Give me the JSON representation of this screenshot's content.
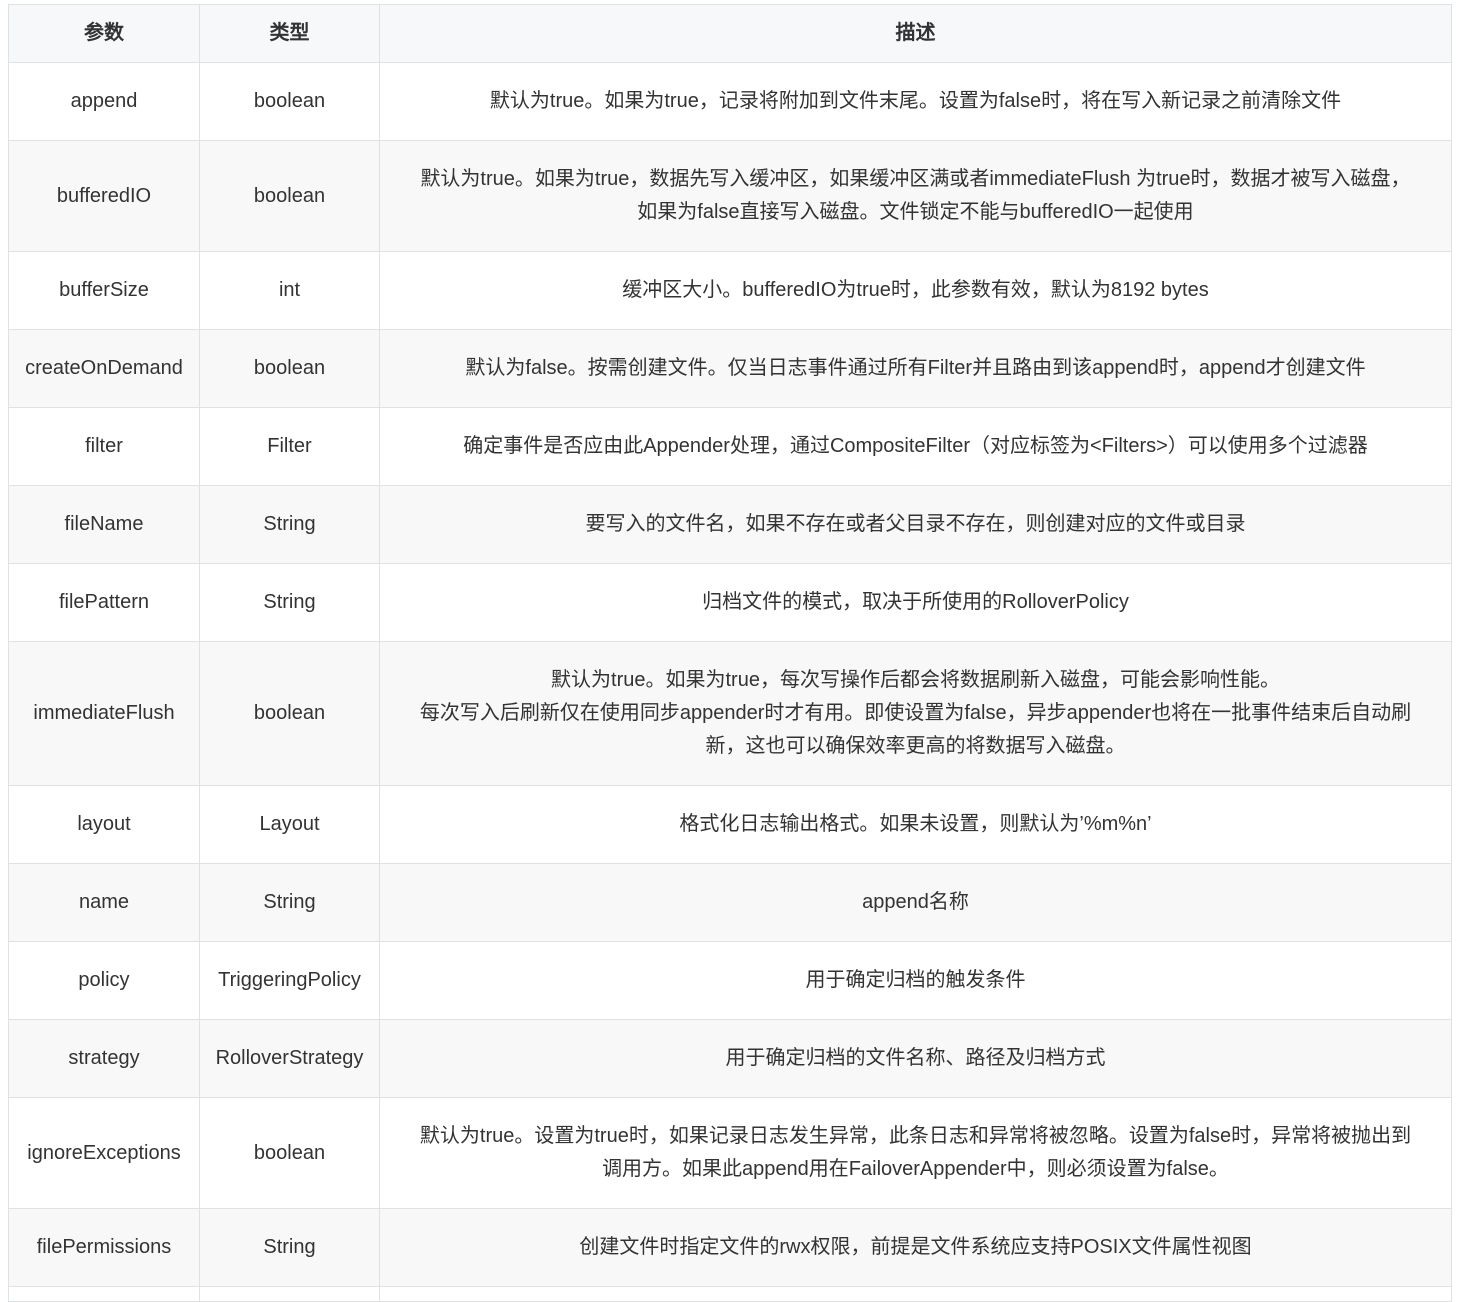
{
  "headers": [
    "参数",
    "类型",
    "描述"
  ],
  "rows": [
    {
      "param": "append",
      "type": "boolean",
      "desc": [
        "默认为true。如果为true，记录将附加到文件末尾。设置为false时，将在写入新记录之前清除文件"
      ]
    },
    {
      "param": "bufferedIO",
      "type": "boolean",
      "desc": [
        "默认为true。如果为true，数据先写入缓冲区，如果缓冲区满或者immediateFlush 为true时，数据才被写入磁盘，",
        "如果为false直接写入磁盘。文件锁定不能与bufferedIO一起使用"
      ]
    },
    {
      "param": "bufferSize",
      "type": "int",
      "desc": [
        "缓冲区大小。bufferedIO为true时，此参数有效，默认为8192 bytes"
      ]
    },
    {
      "param": "createOnDemand",
      "type": "boolean",
      "desc": [
        "默认为false。按需创建文件。仅当日志事件通过所有Filter并且路由到该append时，append才创建文件"
      ]
    },
    {
      "param": "filter",
      "type": "Filter",
      "desc": [
        "确定事件是否应由此Appender处理，通过CompositeFilter（对应标签为<Filters>）可以使用多个过滤器"
      ]
    },
    {
      "param": "fileName",
      "type": "String",
      "desc": [
        "要写入的文件名，如果不存在或者父目录不存在，则创建对应的文件或目录"
      ]
    },
    {
      "param": "filePattern",
      "type": "String",
      "desc": [
        "归档文件的模式，取决于所使用的RolloverPolicy"
      ]
    },
    {
      "param": "immediateFlush",
      "type": "boolean",
      "desc": [
        "默认为true。如果为true，每次写操作后都会将数据刷新入磁盘，可能会影响性能。",
        "每次写入后刷新仅在使用同步appender时才有用。即使设置为false，异步appender也将在一批事件结束后自动刷",
        "新，这也可以确保效率更高的将数据写入磁盘。"
      ]
    },
    {
      "param": "layout",
      "type": "Layout",
      "desc": [
        "格式化日志输出格式。如果未设置，则默认为’%m%n’"
      ]
    },
    {
      "param": "name",
      "type": "String",
      "desc": [
        "append名称"
      ]
    },
    {
      "param": "policy",
      "type": "TriggeringPolicy",
      "desc": [
        "用于确定归档的触发条件"
      ]
    },
    {
      "param": "strategy",
      "type": "RolloverStrategy",
      "desc": [
        "用于确定归档的文件名称、路径及归档方式"
      ]
    },
    {
      "param": "ignoreExceptions",
      "type": "boolean",
      "desc": [
        "默认为true。设置为true时，如果记录日志发生异常，此条日志和异常将被忽略。设置为false时，异常将被抛出到",
        "调用方。如果此append用在FailoverAppender中，则必须设置为false。"
      ]
    },
    {
      "param": "filePermissions",
      "type": "String",
      "desc": [
        "创建文件时指定文件的rwx权限，前提是文件系统应支持POSIX文件属性视图"
      ]
    }
  ]
}
